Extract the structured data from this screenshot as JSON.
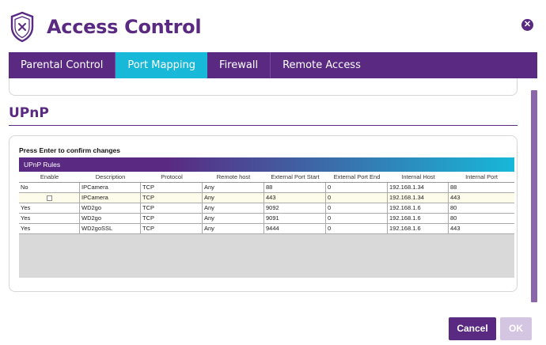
{
  "header": {
    "title": "Access Control",
    "close_symbol": "✕"
  },
  "tabs": [
    {
      "label": "Parental Control"
    },
    {
      "label": "Port Mapping",
      "active": true
    },
    {
      "label": "Firewall"
    },
    {
      "label": "Remote Access"
    }
  ],
  "section": {
    "title": "UPnP"
  },
  "panel": {
    "hint": "Press Enter to confirm changes",
    "grid_caption": "UPnP Rules",
    "columns": [
      "Enable",
      "Description",
      "Protocol",
      "Remote host",
      "External Port Start",
      "External Port End",
      "Internal Host",
      "Internal Port"
    ],
    "rows": [
      [
        "No",
        "IPCamera",
        "TCP",
        "Any",
        "88",
        "0",
        "192.168.1.34",
        "88"
      ],
      [
        "",
        "IPCamera",
        "TCP",
        "Any",
        "443",
        "0",
        "192.168.1.34",
        "443"
      ],
      [
        "Yes",
        "WD2go",
        "TCP",
        "Any",
        "9092",
        "0",
        "192.168.1.6",
        "80"
      ],
      [
        "Yes",
        "WD2go",
        "TCP",
        "Any",
        "9091",
        "0",
        "192.168.1.6",
        "80"
      ],
      [
        "Yes",
        "WD2goSSL",
        "TCP",
        "Any",
        "9444",
        "0",
        "192.168.1.6",
        "443"
      ]
    ]
  },
  "footer": {
    "cancel_label": "Cancel",
    "ok_label": "OK"
  },
  "colors": {
    "brand_purple": "#5a2a82",
    "accent_cyan": "#17b8d8"
  }
}
